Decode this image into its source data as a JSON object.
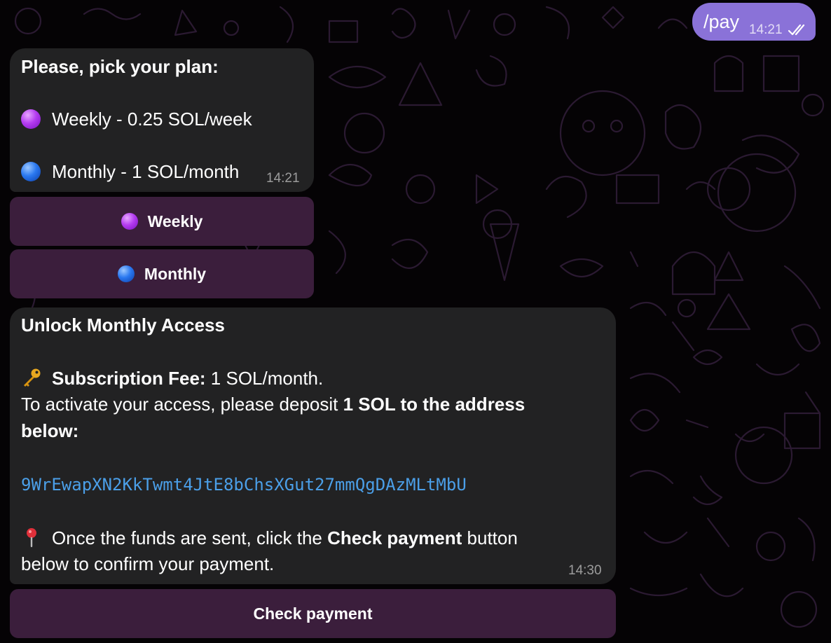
{
  "outgoing": {
    "text": "/pay",
    "time": "14:21",
    "status_icon": "double-check-icon"
  },
  "plan_message": {
    "title": "Please, pick your plan:",
    "options": [
      {
        "icon": "purple-circle-icon",
        "label": "Weekly - 0.25 SOL/week"
      },
      {
        "icon": "blue-circle-icon",
        "label": "Monthly - 1 SOL/month"
      }
    ],
    "time": "14:21"
  },
  "plan_buttons": [
    {
      "icon": "purple-circle-icon",
      "label": "Weekly"
    },
    {
      "icon": "blue-circle-icon",
      "label": "Monthly"
    }
  ],
  "access_message": {
    "title": "Unlock Monthly Access",
    "fee_icon": "key-icon",
    "fee_label": "Subscription Fee:",
    "fee_value": " 1 SOL/month.",
    "deposit_text": "To activate your access, please deposit ",
    "deposit_bold": "1 SOL to the address",
    "deposit_line2": "below:",
    "address": "9WrEwapXN2KkTwmt4JtE8bChsXGut27mmQgDAzMLtMbU",
    "pin_icon": "pushpin-icon",
    "instruction_pre": "Once the funds are sent, click the ",
    "instruction_bold": "Check payment",
    "instruction_post": " button",
    "instruction_line2": "below to confirm your payment.",
    "time": "14:30"
  },
  "check_button": {
    "label": "Check payment"
  },
  "colors": {
    "outgoing_bubble": "#8a72d8",
    "incoming_bubble": "#222223",
    "keyboard_button": "#3b1e3c",
    "link": "#4b9fe8",
    "background": "#050305"
  }
}
